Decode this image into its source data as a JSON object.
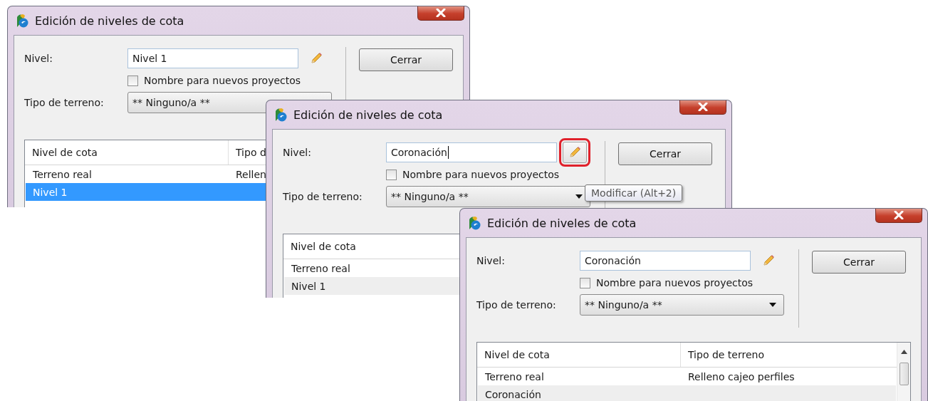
{
  "windows": [
    {
      "title": "Edición de niveles de cota",
      "nivel_label": "Nivel:",
      "nivel_value": "Nivel 1",
      "edit_button": {
        "hovered": false,
        "highlighted": false
      },
      "checkbox": {
        "label": "Nombre para nuevos proyectos",
        "checked": false
      },
      "terrain_label": "Tipo de terreno:",
      "terrain_value": "** Ninguno/a **",
      "close_button": "Cerrar",
      "list_focused": true,
      "columns": [
        "Nivel de cota",
        "Tipo d"
      ],
      "rows": [
        {
          "cells": [
            "Terreno real",
            "Rellen"
          ],
          "selected": false
        },
        {
          "cells": [
            "Nivel 1"
          ],
          "selected": true
        }
      ]
    },
    {
      "title": "Edición de niveles de cota",
      "nivel_label": "Nivel:",
      "nivel_value": "Coronación",
      "caret": true,
      "edit_button": {
        "hovered": true,
        "highlighted": true
      },
      "checkbox": {
        "label": "Nombre para nuevos proyectos",
        "checked": false
      },
      "terrain_label": "Tipo de terreno:",
      "terrain_value": "** Ninguno/a **",
      "close_button": "Cerrar",
      "tooltip": "Modificar (Alt+2)",
      "list_focused": false,
      "columns": [
        "Nivel de cota"
      ],
      "rows": [
        {
          "cells": [
            "Terreno real"
          ],
          "selected": false
        },
        {
          "cells": [
            "Nivel 1"
          ],
          "selected": true
        }
      ]
    },
    {
      "title": "Edición de niveles de cota",
      "nivel_label": "Nivel:",
      "nivel_value": "Coronación",
      "edit_button": {
        "hovered": false,
        "highlighted": false
      },
      "checkbox": {
        "label": "Nombre para nuevos proyectos",
        "checked": false
      },
      "terrain_label": "Tipo de terreno:",
      "terrain_value": "** Ninguno/a **",
      "close_button": "Cerrar",
      "list_focused": false,
      "list_scrollbar": true,
      "columns": [
        "Nivel de cota",
        "Tipo de terreno"
      ],
      "rows": [
        {
          "cells": [
            "Terreno real",
            "Relleno cajeo perfiles"
          ],
          "selected": false
        },
        {
          "cells": [
            "Coronación"
          ],
          "selected": true
        }
      ]
    }
  ]
}
